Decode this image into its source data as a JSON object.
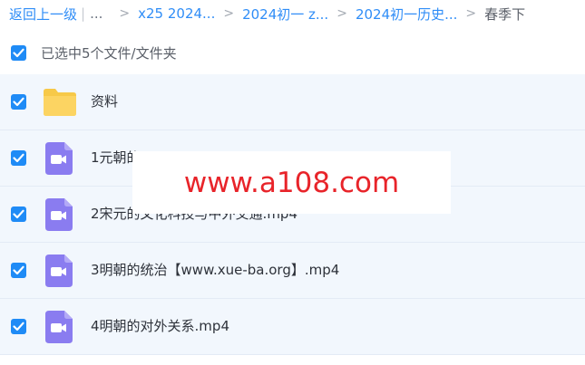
{
  "breadcrumb": {
    "back": "返回上一级",
    "ellipsis": "...",
    "items": [
      "x25 2024...",
      "2024初一 z...",
      "2024初一历史..."
    ],
    "current": "春季下"
  },
  "selection": {
    "label": "已选中5个文件/文件夹",
    "checked": true
  },
  "files": [
    {
      "name": "资料",
      "icon": "folder-icon",
      "checked": true
    },
    {
      "name": "1元朝的",
      "icon": "video-file-icon",
      "checked": true
    },
    {
      "name": "2宋元的文化科技与中外交通.mp4",
      "icon": "video-file-icon",
      "checked": true
    },
    {
      "name": "3明朝的统治【www.xue-ba.org】.mp4",
      "icon": "video-file-icon",
      "checked": true
    },
    {
      "name": "4明朝的对外关系.mp4",
      "icon": "video-file-icon",
      "checked": true
    }
  ],
  "watermark": "www.a108.com",
  "colors": {
    "accent": "#1f8bf6",
    "link": "#2f8df7",
    "row_bg": "#f2f7fd",
    "folder": "#fcd462",
    "video_icon": "#8a7cf0",
    "watermark": "#e8242a"
  }
}
